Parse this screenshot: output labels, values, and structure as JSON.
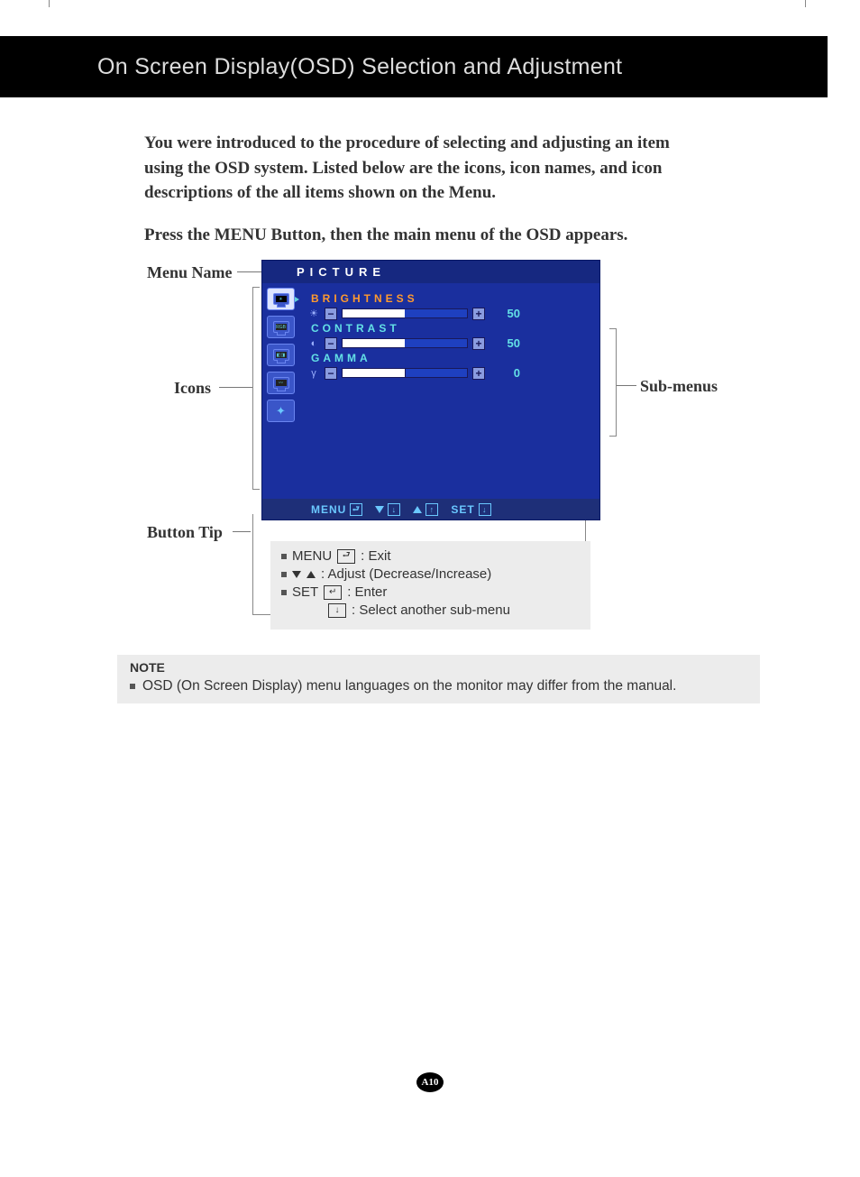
{
  "header": {
    "title": "On Screen Display(OSD) Selection and Adjustment"
  },
  "intro": "You were introduced to the procedure of selecting and adjusting an item using the OSD system.  Listed below are the icons, icon names, and icon descriptions of the all items shown on the Menu.",
  "press": "Press the MENU Button, then the main menu of the OSD appears.",
  "labels": {
    "menu_name": "Menu Name",
    "icons": "Icons",
    "button_tip": "Button Tip",
    "sub_menus": "Sub-menus"
  },
  "osd": {
    "title": "PICTURE",
    "footer_menu": "MENU",
    "footer_set": "SET",
    "rows": [
      {
        "label": "BRIGHTNESS",
        "value": "50"
      },
      {
        "label": "CONTRAST",
        "value": "50"
      },
      {
        "label": "GAMMA",
        "value": "0"
      }
    ]
  },
  "tips": {
    "menu_label": "MENU",
    "menu_desc": ": Exit",
    "adjust_desc": ": Adjust (Decrease/Increase)",
    "set_label": "SET",
    "set_desc": ": Enter",
    "select_desc": ": Select another sub-menu"
  },
  "note": {
    "title": "NOTE",
    "body": "OSD (On Screen Display) menu languages on the monitor may differ from the manual."
  },
  "page_number": "A10"
}
